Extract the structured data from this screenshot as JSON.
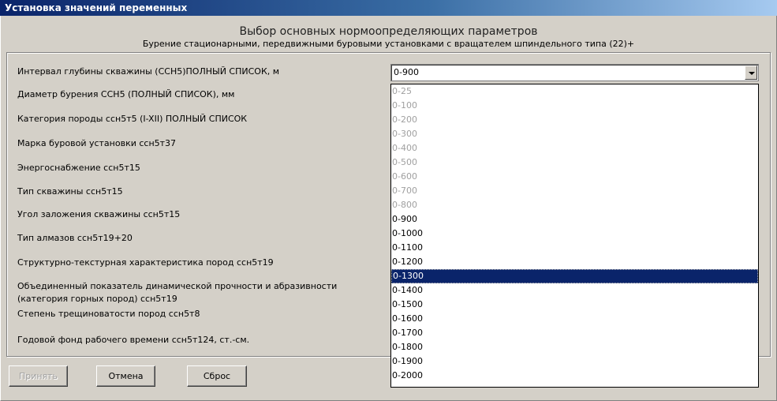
{
  "window": {
    "title": "Установка значений переменных"
  },
  "header": {
    "title": "Выбор основных нормоопределяющих параметров",
    "subtitle": "Бурение стационарными, передвижными буровыми установками с вращателем шпиндельного типа (22)+"
  },
  "params": [
    {
      "label": "Интервал глубины скважины (ССН5)ПОЛНЫЙ СПИСОК, м",
      "value": "0-900"
    },
    {
      "label": "Диаметр бурения ССН5 (ПОЛНЫЙ СПИСОК), мм"
    },
    {
      "label": "Категория породы ссн5т5 (I-XII) ПОЛНЫЙ СПИСОК"
    },
    {
      "label": "Марка буровой установки ссн5т37"
    },
    {
      "label": "Энергоснабжение ссн5т15"
    },
    {
      "label": "Тип скважины ссн5т15"
    },
    {
      "label": "Угол заложения скважины ссн5т15"
    },
    {
      "label": "Тип алмазов ссн5т19+20"
    },
    {
      "label": "Структурно-текстурная характеристика пород ссн5т19"
    },
    {
      "label": "Объединенный показатель динамической прочности и абразивности\n(категория горных пород) ссн5т19"
    },
    {
      "label": "Степень трещиноватости пород ссн5т8"
    },
    {
      "label": "Годовой фонд рабочего времени ссн5т124, ст.-см."
    }
  ],
  "dropdown": {
    "options": [
      {
        "label": "0-25",
        "state": "disabled"
      },
      {
        "label": "0-100",
        "state": "disabled"
      },
      {
        "label": "0-200",
        "state": "disabled"
      },
      {
        "label": "0-300",
        "state": "disabled"
      },
      {
        "label": "0-400",
        "state": "disabled"
      },
      {
        "label": "0-500",
        "state": "disabled"
      },
      {
        "label": "0-600",
        "state": "disabled"
      },
      {
        "label": "0-700",
        "state": "disabled"
      },
      {
        "label": "0-800",
        "state": "disabled"
      },
      {
        "label": "0-900",
        "state": "enabled"
      },
      {
        "label": "0-1000",
        "state": "enabled"
      },
      {
        "label": "0-1100",
        "state": "enabled"
      },
      {
        "label": "0-1200",
        "state": "enabled"
      },
      {
        "label": "0-1300",
        "state": "selected"
      },
      {
        "label": "0-1400",
        "state": "enabled"
      },
      {
        "label": "0-1500",
        "state": "enabled"
      },
      {
        "label": "0-1600",
        "state": "enabled"
      },
      {
        "label": "0-1700",
        "state": "enabled"
      },
      {
        "label": "0-1800",
        "state": "enabled"
      },
      {
        "label": "0-1900",
        "state": "enabled"
      },
      {
        "label": "0-2000",
        "state": "enabled"
      }
    ]
  },
  "buttons": {
    "accept": {
      "label": "Принять",
      "state": "disabled"
    },
    "cancel": {
      "label": "Отмена"
    },
    "reset": {
      "label": "Сброс"
    }
  },
  "colors": {
    "titlebar": "#0a246a",
    "selection": "#0a246a",
    "face": "#d4d0c8"
  }
}
